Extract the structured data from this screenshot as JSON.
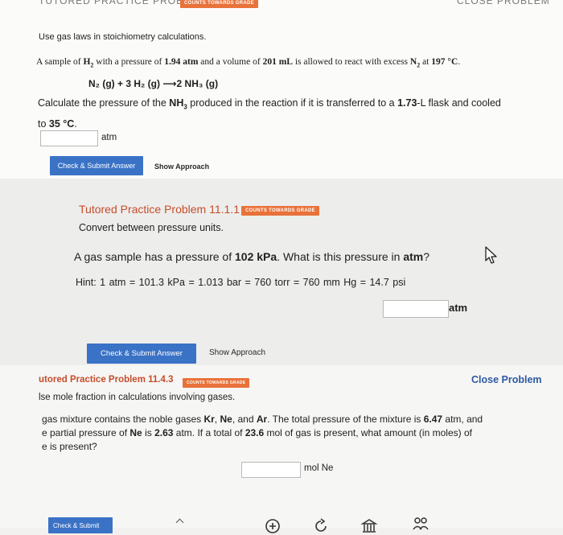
{
  "top_problem": {
    "header_cut_left": "TUTORED PRACTICE PROBLEM",
    "header_badge": "COUNTS TOWARDS GRADE",
    "header_cut_right": "CLOSE PROBLEM",
    "instruction": "Use gas laws in stoichiometry calculations.",
    "statement_pre": "A sample of ",
    "statement_h2": "H",
    "statement_sub": "2",
    "statement_mid1": " with a pressure of ",
    "pressure": "1.94 atm",
    "statement_mid2": " and a volume of ",
    "volume": "201 mL",
    "statement_mid3": " is allowed to react with excess ",
    "statement_n2": "N",
    "statement_mid4": " at ",
    "temperature": "197 °C",
    "statement_end": ".",
    "equation": "N₂ (g) + 3 H₂ (g) ⟶2 NH₃ (g)",
    "question_pre": "Calculate the pressure of the ",
    "question_nh3": "NH",
    "question_sub": "3",
    "question_mid": " produced in the reaction if it is transferred to a ",
    "flask": "1.73",
    "question_mid2": "-L flask and cooled",
    "question_line2_pre": "to ",
    "question_temp": "35 °C",
    "question_end": ".",
    "answer_value": "",
    "unit": "atm",
    "submit_label": "Check & Submit Answer",
    "approach_label": "Show Approach"
  },
  "middle_problem": {
    "title": "Tutored Practice Problem 11.1.1",
    "badge": "COUNTS TOWARDS GRADE",
    "subtitle": "Convert between pressure units.",
    "question_pre": "A gas sample has a pressure of ",
    "question_value": "102 kPa",
    "question_mid": ". What is this pressure in ",
    "question_unit": "atm",
    "question_end": "?",
    "hint": "Hint: 1 atm = 101.3 kPa = 1.013 bar = 760 torr = 760 mm Hg = 14.7 psi",
    "answer_value": "",
    "unit": "atm",
    "submit_label": "Check & Submit Answer",
    "approach_label": "Show Approach"
  },
  "bottom_problem": {
    "title": "utored Practice Problem 11.4.3",
    "badge": "COUNTS TOWARDS GRADE",
    "close_label": "Close Problem",
    "subtitle": "lse mole fraction in calculations involving gases.",
    "line1_pre": "gas mixture contains the noble gases ",
    "kr": "Kr",
    "sep1": ", ",
    "ne": "Ne",
    "sep2": ", and ",
    "ar": "Ar",
    "line1_mid": ". The total pressure of the mixture is ",
    "total_pressure": "6.47",
    "line1_end": " atm, and",
    "line2_pre": "e partial pressure of ",
    "ne2": "Ne",
    "line2_mid": " is ",
    "partial_pressure": "2.63",
    "line2_mid2": " atm. If a total of ",
    "total_mol": "23.6",
    "line2_end": " mol of gas is present, what amount (in moles) of",
    "line3": "e is present?",
    "answer_value": "",
    "unit": "mol Ne",
    "submit_label": "Check & Submit"
  },
  "icons": [
    "add-icon",
    "refresh-icon",
    "bank-icon",
    "group-icon"
  ]
}
